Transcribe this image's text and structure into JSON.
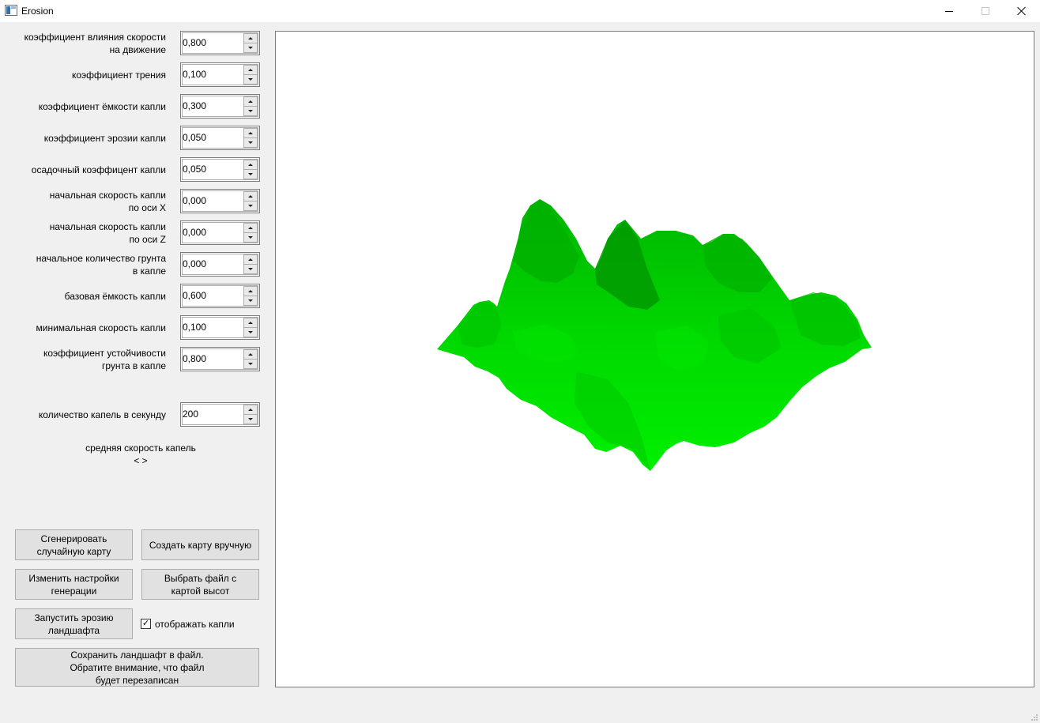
{
  "window": {
    "title": "Erosion",
    "minimize_icon": "minimize-icon",
    "maximize_icon": "maximize-icon",
    "close_icon": "close-icon"
  },
  "params": [
    {
      "label_lines": [
        "коэффициент влияния скорости",
        "на движение"
      ],
      "value": "0,800"
    },
    {
      "label_lines": [
        "коэффициент трения"
      ],
      "value": "0,100"
    },
    {
      "label_lines": [
        "коэффициент ёмкости капли"
      ],
      "value": "0,300"
    },
    {
      "label_lines": [
        "коэффициент эрозии капли"
      ],
      "value": "0,050"
    },
    {
      "label_lines": [
        "осадочный коэффицент капли"
      ],
      "value": "0,050"
    },
    {
      "label_lines": [
        "начальная скорость капли",
        "по оси X"
      ],
      "value": "0,000"
    },
    {
      "label_lines": [
        "начальная скорость капли",
        "по оси Z"
      ],
      "value": "0,000"
    },
    {
      "label_lines": [
        "начальное количество грунта",
        "в капле"
      ],
      "value": "0,000"
    },
    {
      "label_lines": [
        "базовая ёмкость капли"
      ],
      "value": "0,600"
    },
    {
      "label_lines": [
        "минимальная скорость капли"
      ],
      "value": "0,100"
    },
    {
      "label_lines": [
        "коэффициент устойчивости",
        "грунта в капле"
      ],
      "value": "0,800"
    }
  ],
  "drops_per_second": {
    "label": "количество капель в секунду",
    "value": "200"
  },
  "avg_speed": {
    "line1": "средняя скорость капель",
    "line2": "< >"
  },
  "buttons": {
    "generate_random": [
      "Сгенерировать",
      "случайную карту"
    ],
    "create_manual": [
      "Создать карту вручную"
    ],
    "change_settings": [
      "Изменить настройки",
      "генерации"
    ],
    "choose_file": [
      "Выбрать файл с",
      "картой высот"
    ],
    "start_erosion": [
      "Запустить эрозию",
      "ландшафта"
    ],
    "save_landscape": [
      "Сохранить ландшафт в файл.",
      "Обратите внимание, что файл",
      "будет перезаписан"
    ]
  },
  "show_drops": {
    "label": "отображать капли",
    "checked": true,
    "check_glyph": "✓"
  },
  "colors": {
    "terrain_bright": "#00e000",
    "terrain_dark": "#007a00",
    "window_bg": "#f0f0f0",
    "viewport_bg": "#ffffff"
  }
}
